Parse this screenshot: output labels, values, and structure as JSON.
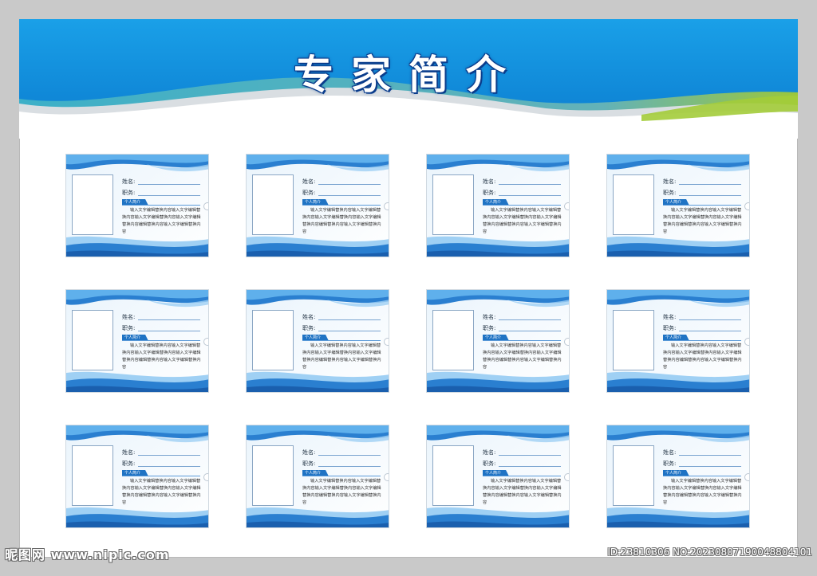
{
  "header": {
    "title": "专家简介"
  },
  "card_template": {
    "name_label": "姓名:",
    "position_label": "职务:",
    "intro_tag": "个人简介",
    "intro_text": "输入文字编辑替换内容输入文字编辑替换内容输入文字编辑替换内容输入文字编辑替换内容编辑替换内容输入文字编辑替换内容"
  },
  "cards": [
    {
      "id": "1"
    },
    {
      "id": "2"
    },
    {
      "id": "3"
    },
    {
      "id": "4"
    },
    {
      "id": "5"
    },
    {
      "id": "6"
    },
    {
      "id": "7"
    },
    {
      "id": "8"
    },
    {
      "id": "9"
    },
    {
      "id": "10"
    },
    {
      "id": "11"
    },
    {
      "id": "12"
    }
  ],
  "watermark": {
    "site": "昵图网 www.nipic.com",
    "id_text": "ID:23810306 NO:20230807190048804101"
  },
  "colors": {
    "frame": "#c9c9c9",
    "header_blue": "#1b9ae4",
    "accent_green": "#8fc31f",
    "card_blue": "#1f73c4"
  }
}
